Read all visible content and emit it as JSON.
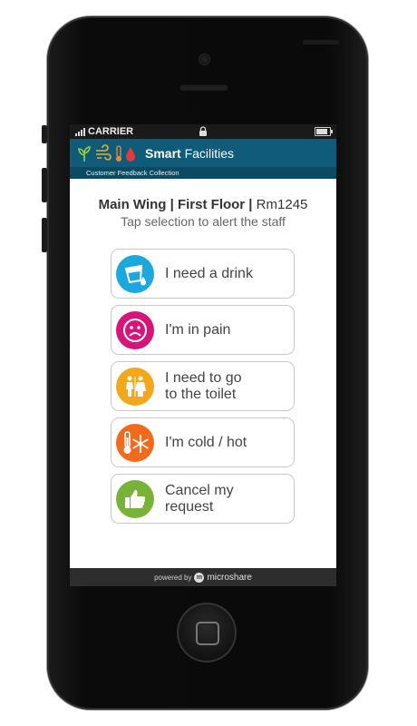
{
  "status_bar": {
    "carrier": "CARRIER",
    "battery_level": 0.85
  },
  "app": {
    "title_bold": "Smart",
    "title_rest": " Facilities",
    "subtitle": "Customer Feedback Collection",
    "brand_color": "#0f5b79"
  },
  "location": {
    "bold": "Main Wing | First Floor |",
    "rest": " Rm1245"
  },
  "instruction": "Tap selection to alert the staff",
  "choices": [
    {
      "label": "I need a drink",
      "icon": "glass-water-icon",
      "color": "#1ba8dc"
    },
    {
      "label": "I'm in pain",
      "icon": "sad-face-icon",
      "color": "#d6157a"
    },
    {
      "label": "I need to go\nto the toilet",
      "icon": "toilet-icon",
      "color": "#f2a81d"
    },
    {
      "label": "I'm cold / hot",
      "icon": "thermometer-snowflake-icon",
      "color": "#f26a1c"
    },
    {
      "label": "Cancel my\nrequest",
      "icon": "thumbs-up-icon",
      "color": "#78b337"
    }
  ],
  "footer": {
    "powered_by": "powered by",
    "brand": "microshare"
  }
}
